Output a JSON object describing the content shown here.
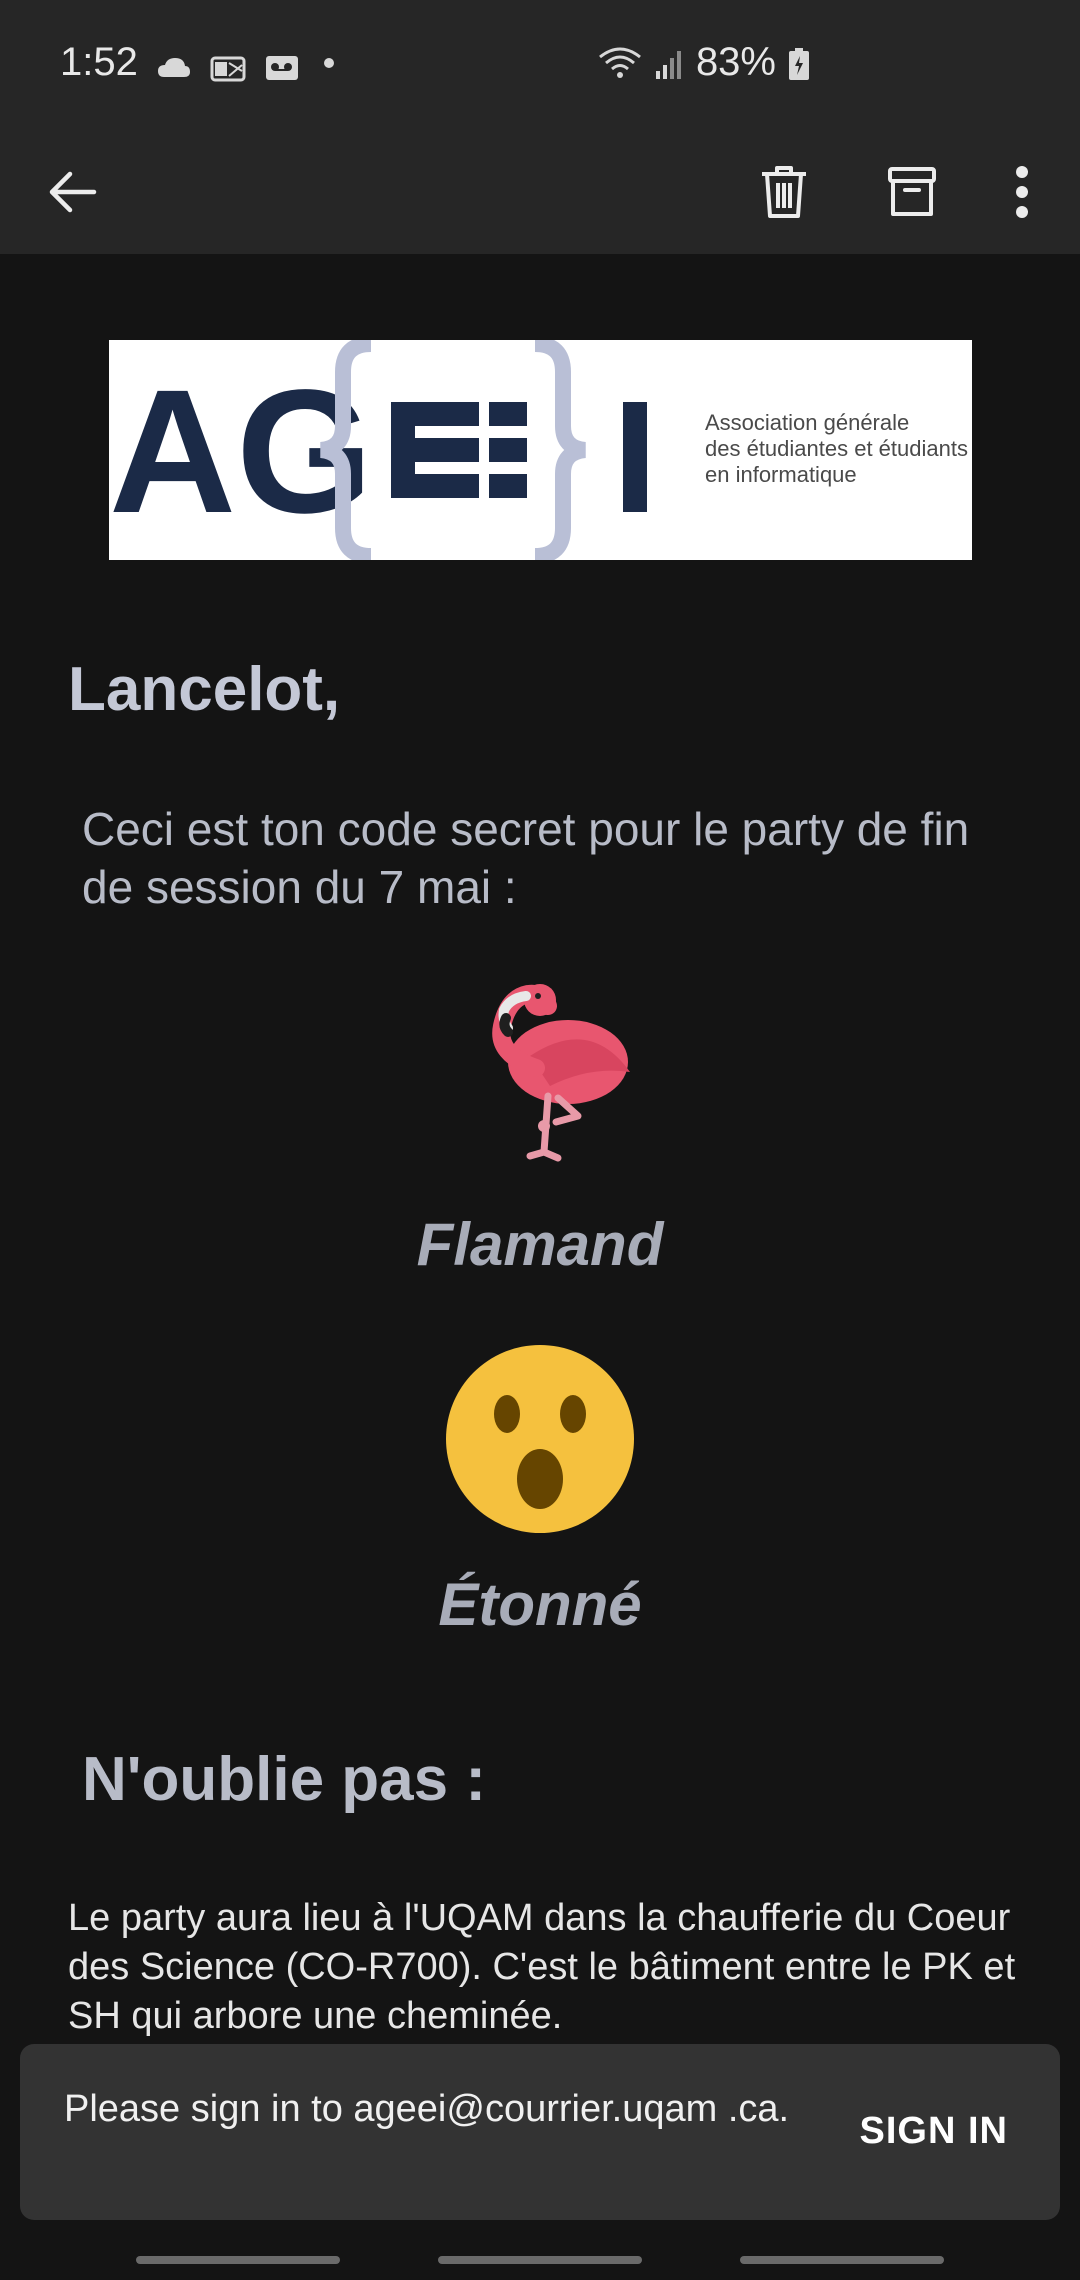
{
  "status_bar": {
    "time": "1:52",
    "battery": "83%"
  },
  "toolbar": {
    "back_icon": "arrow-left-icon",
    "delete_icon": "trash-icon",
    "archive_icon": "archive-icon",
    "more_icon": "more-vert-icon"
  },
  "email": {
    "logo": {
      "letters_left": "AG",
      "letters_middle": "E",
      "letter_right": "I",
      "tagline_1": "Association générale",
      "tagline_2": "des étudiantes et étudiants",
      "tagline_3": "en informatique"
    },
    "greeting": "Lancelot,",
    "intro": "Ceci est ton code secret pour le party de fin de session du 7 mai :",
    "codes": [
      {
        "icon": "flamingo-icon",
        "word": "Flamand"
      },
      {
        "icon": "astonished-face-icon",
        "word": "Étonné"
      }
    ],
    "reminder_heading": "N'oublie pas :",
    "reminder_body": "Le party aura lieu à l'UQAM dans la chaufferie du Coeur des Science (CO-R700). C'est le bâtiment entre le PK et SH qui arbore une cheminée."
  },
  "snackbar": {
    "message": "Please sign in to ageei@courrier.uqam .ca.",
    "action": "SIGN IN"
  },
  "colors": {
    "background": "#141414",
    "bar": "#262626",
    "snackbar": "#333333",
    "logo_navy": "#1b2a47",
    "logo_lavender": "#b9bfd6"
  }
}
